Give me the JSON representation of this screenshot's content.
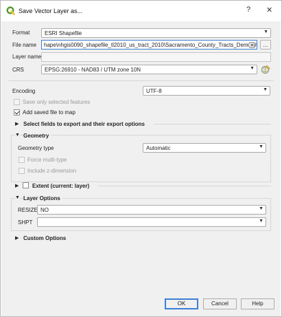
{
  "window": {
    "title": "Save Vector Layer as..."
  },
  "titlebar_buttons": {
    "help": "?",
    "close": "✕"
  },
  "form": {
    "format_label": "Format",
    "format_value": "ESRI Shapefile",
    "filename_label": "File name",
    "filename_value": "hape\\nhgis0090_shapefile_tl2010_us_tract_2010\\Sacramento_County_Tracts_Dems.shp",
    "browse_label": "...",
    "layername_label": "Layer name",
    "layername_value": "",
    "crs_label": "CRS",
    "crs_value": "EPSG:26910 - NAD83 / UTM zone 10N"
  },
  "options": {
    "encoding_label": "Encoding",
    "encoding_value": "UTF-8",
    "save_selected_label": "Save only selected features",
    "add_saved_label": "Add saved file to map"
  },
  "sections": {
    "select_fields": "Select fields to export and their export options",
    "geometry": "Geometry",
    "extent": "Extent (current: layer)",
    "layer_options": "Layer Options",
    "custom_options": "Custom Options"
  },
  "geometry": {
    "type_label": "Geometry type",
    "type_value": "Automatic",
    "force_multi_label": "Force multi-type",
    "include_z_label": "Include z-dimension"
  },
  "layer_options": {
    "resize_label": "RESIZE",
    "resize_value": "NO",
    "shpt_label": "SHPT",
    "shpt_value": ""
  },
  "buttons": {
    "ok": "OK",
    "cancel": "Cancel",
    "help": "Help"
  },
  "colors": {
    "accent": "#3b7fd3",
    "qgis_green": "#589632",
    "qgis_yellow": "#f0c53d"
  }
}
